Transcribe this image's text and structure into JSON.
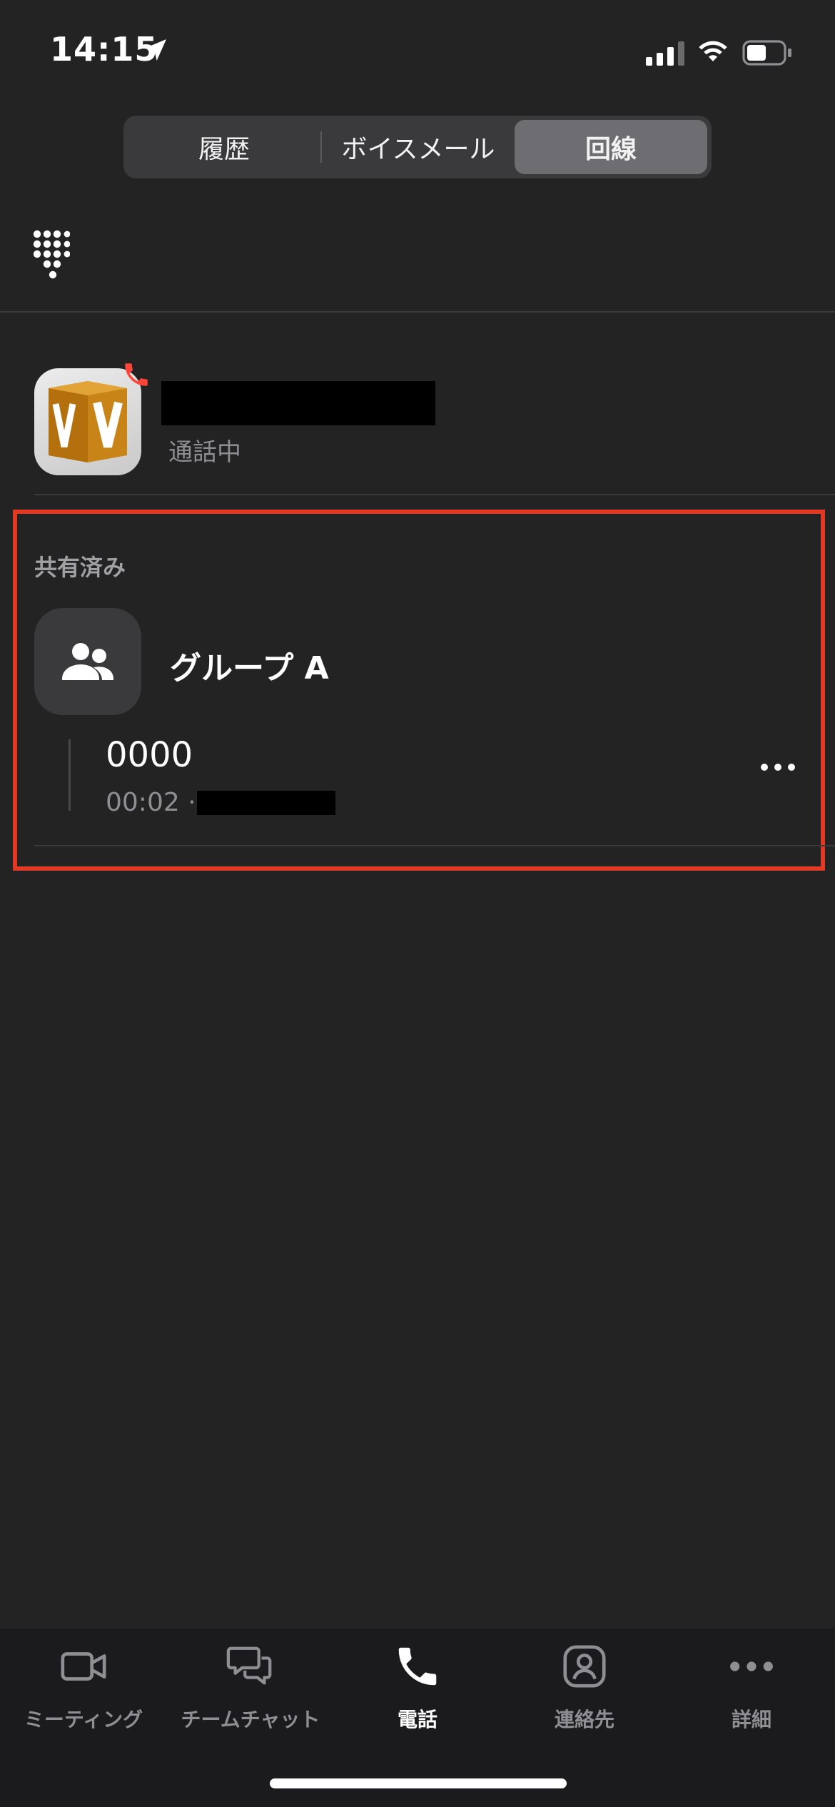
{
  "status_bar": {
    "time": "14:15"
  },
  "segmented": {
    "tabs": [
      {
        "label": "履歴"
      },
      {
        "label": "ボイスメール"
      },
      {
        "label": "回線"
      }
    ],
    "active_index": 2
  },
  "active_call": {
    "status": "通話中"
  },
  "shared": {
    "section_label": "共有済み",
    "group_name": "グループ A",
    "line_number": "0000",
    "duration": "00:02 ·"
  },
  "tabbar": {
    "items": [
      {
        "label": "ミーティング",
        "icon": "video-icon"
      },
      {
        "label": "チームチャット",
        "icon": "chat-icon"
      },
      {
        "label": "電話",
        "icon": "phone-icon"
      },
      {
        "label": "連絡先",
        "icon": "contacts-icon"
      },
      {
        "label": "詳細",
        "icon": "more-icon"
      }
    ],
    "active_index": 2
  },
  "colors": {
    "background": "#232323",
    "accent_red": "#e03a24",
    "segment_active": "#6e6e72"
  }
}
